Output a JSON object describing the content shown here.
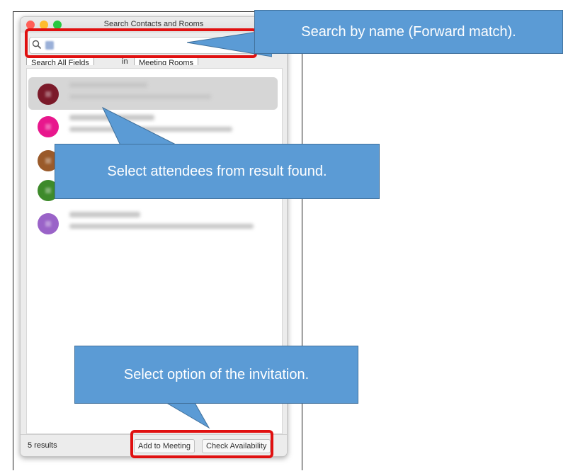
{
  "window": {
    "title": "Search Contacts and Rooms",
    "traffic_lights": [
      "#ff5f57",
      "#febc2e",
      "#28c840"
    ]
  },
  "search": {
    "icon": "magnifier-icon"
  },
  "filters": {
    "field_select": "Search All Fields",
    "in_label": "in",
    "scope_select": "Meeting Rooms"
  },
  "results": [
    {
      "avatar_color": "#7b1a2a"
    },
    {
      "avatar_color": "#e8178d"
    },
    {
      "avatar_color": "#9a5a2a"
    },
    {
      "avatar_color": "#3d8a2a"
    },
    {
      "avatar_color": "#9a63c8"
    }
  ],
  "footer": {
    "count": "5 results",
    "add_to_meeting": "Add to Meeting",
    "check_availability": "Check Availability"
  },
  "callouts": {
    "search": "Search by name (Forward match).",
    "select": "Select attendees from result found.",
    "option": "Select option of the invitation."
  },
  "colors": {
    "callout": "#5b9bd5",
    "highlight": "#e01010"
  }
}
